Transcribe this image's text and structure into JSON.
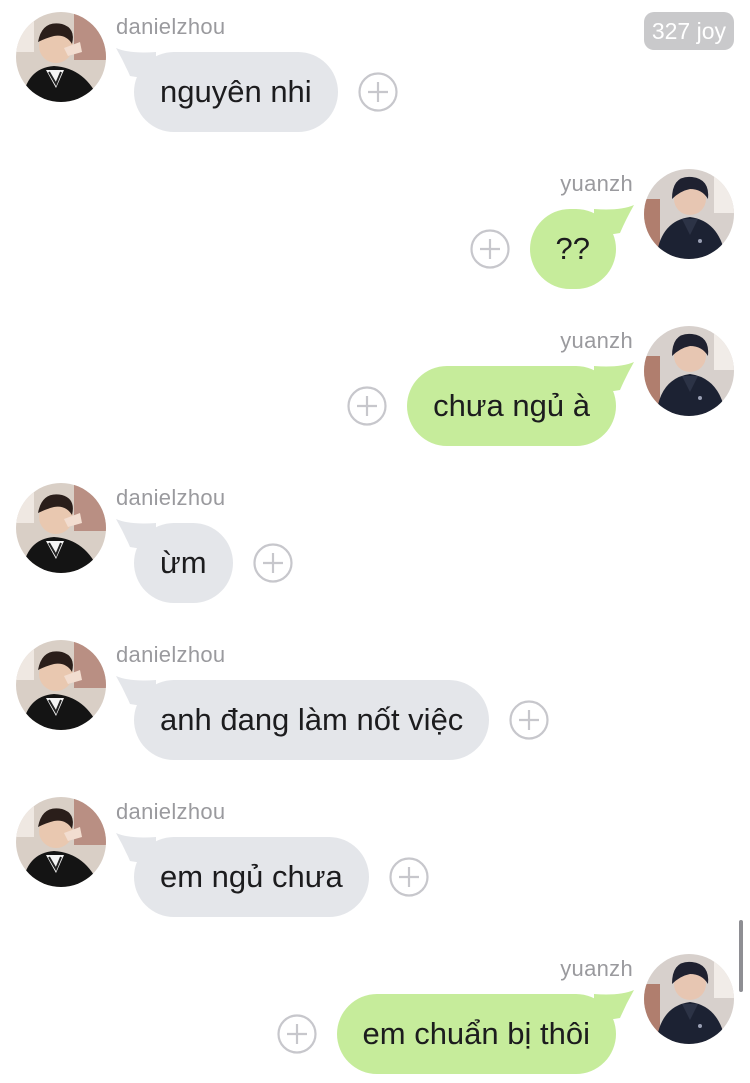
{
  "chat": {
    "counter_badge": "327 joy",
    "messages": [
      {
        "side": "left",
        "sender": "danielzhou",
        "text": "nguyên nhi"
      },
      {
        "side": "right",
        "sender": "yuanzh",
        "text": "??"
      },
      {
        "side": "right",
        "sender": "yuanzh",
        "text": "chưa ngủ à"
      },
      {
        "side": "left",
        "sender": "danielzhou",
        "text": "ừm"
      },
      {
        "side": "left",
        "sender": "danielzhou",
        "text": "anh đang làm nốt việc"
      },
      {
        "side": "left",
        "sender": "danielzhou",
        "text": "em ngủ chưa"
      },
      {
        "side": "right",
        "sender": "yuanzh",
        "text": "em chuẩn bị thôi"
      }
    ]
  },
  "colors": {
    "incoming_bubble": "#e4e6ea",
    "outgoing_bubble": "#c6ec9b",
    "sender_name": "#9a9a9e",
    "badge_background": "#c9c9cb"
  },
  "icons": {
    "add_reaction": "plus-circle-icon",
    "avatar": "avatar-photo"
  }
}
